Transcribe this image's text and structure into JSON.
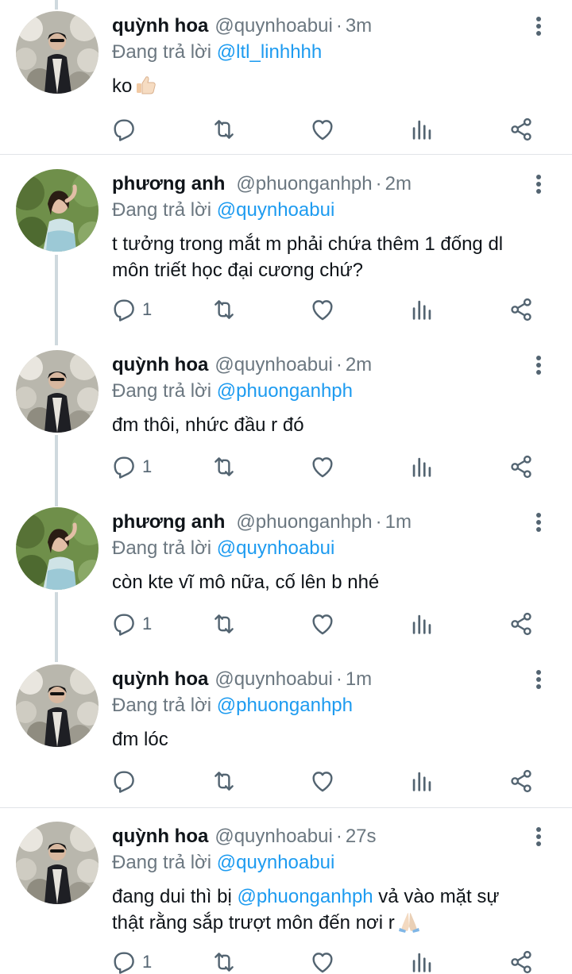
{
  "reply_prefix": "Đang trả lời",
  "tweets": [
    {
      "name": "quỳnh hoa",
      "handle": "@quynhoabui",
      "time": "3m",
      "replying_to": "@ltl_linhhhh",
      "text": "ko",
      "emoji": "thumbs-up-icon",
      "reply_count": "",
      "avatar": "quynh"
    },
    {
      "name": "phương anh",
      "handle": "@phuonganhph",
      "time": "2m",
      "replying_to": "@quynhoabui",
      "text": "t tưởng trong mắt m phải chứa thêm 1 đống dl môn triết học đại cương chứ?",
      "reply_count": "1",
      "avatar": "phuong"
    },
    {
      "name": "quỳnh hoa",
      "handle": "@quynhoabui",
      "time": "2m",
      "replying_to": "@phuonganhph",
      "text": "đm thôi, nhức đầu r đó",
      "reply_count": "1",
      "avatar": "quynh"
    },
    {
      "name": "phương anh",
      "handle": "@phuonganhph",
      "time": "1m",
      "replying_to": "@quynhoabui",
      "text": "còn kte vĩ mô nữa, cố lên b nhé",
      "reply_count": "1",
      "avatar": "phuong"
    },
    {
      "name": "quỳnh hoa",
      "handle": "@quynhoabui",
      "time": "1m",
      "replying_to": "@phuonganhph",
      "text": "đm lóc",
      "reply_count": "",
      "avatar": "quynh"
    },
    {
      "name": "quỳnh hoa",
      "handle": "@quynhoabui",
      "time": "27s",
      "replying_to": "@quynhoabui",
      "text_before": "đang dui thì bị ",
      "text_mention": "@phuonganhph",
      "text_after": " vả vào mặt sự thật rằng sắp trượt môn đến nơi r",
      "emoji": "folded-hands-icon",
      "reply_count": "1",
      "avatar": "quynh"
    }
  ],
  "icons": {
    "reply": "reply-icon",
    "retweet": "retweet-icon",
    "like": "heart-icon",
    "views": "analytics-icon",
    "share": "share-icon",
    "more": "more-options-icon"
  },
  "colors": {
    "link": "#1d9bf0",
    "muted": "#6b7780",
    "separator": "#e1e4e8",
    "thread_line": "#cfd9de"
  }
}
